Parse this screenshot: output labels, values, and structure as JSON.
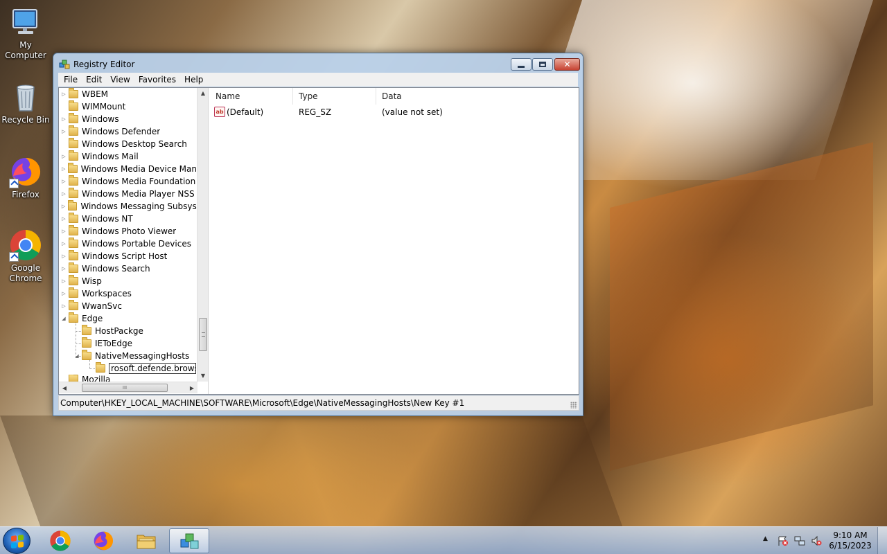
{
  "desktop": {
    "icons": [
      {
        "label": "My Computer",
        "icon": "computer-icon"
      },
      {
        "label": "Recycle Bin",
        "icon": "recycle-bin-icon"
      },
      {
        "label": "Firefox",
        "icon": "firefox-icon"
      },
      {
        "label": "Google Chrome",
        "icon": "chrome-icon"
      }
    ]
  },
  "window": {
    "title": "Registry Editor",
    "menu": [
      "File",
      "Edit",
      "View",
      "Favorites",
      "Help"
    ],
    "tree": [
      {
        "label": "WBEM"
      },
      {
        "label": "WIMMount"
      },
      {
        "label": "Windows"
      },
      {
        "label": "Windows Defender"
      },
      {
        "label": "Windows Desktop Search"
      },
      {
        "label": "Windows Mail"
      },
      {
        "label": "Windows Media Device Manag"
      },
      {
        "label": "Windows Media Foundation"
      },
      {
        "label": "Windows Media Player NSS"
      },
      {
        "label": "Windows Messaging Subsyster"
      },
      {
        "label": "Windows NT"
      },
      {
        "label": "Windows Photo Viewer"
      },
      {
        "label": "Windows Portable Devices"
      },
      {
        "label": "Windows Script Host"
      },
      {
        "label": "Windows Search"
      },
      {
        "label": "Wisp"
      },
      {
        "label": "Workspaces"
      },
      {
        "label": "WwanSvc"
      },
      {
        "label": "Edge"
      },
      {
        "label": "HostPackge"
      },
      {
        "label": "IEToEdge"
      },
      {
        "label": "NativeMessagingHosts"
      },
      {
        "label": "rosoft.defende.browser"
      },
      {
        "label": "Mozilla"
      }
    ],
    "columns": {
      "name": "Name",
      "type": "Type",
      "data": "Data"
    },
    "values": [
      {
        "name": "(Default)",
        "type": "REG_SZ",
        "data": "(value not set)",
        "icon": "string-value-icon"
      }
    ],
    "status": "Computer\\HKEY_LOCAL_MACHINE\\SOFTWARE\\Microsoft\\Edge\\NativeMessagingHosts\\New Key #1",
    "hscroll_thumb_glyph": "III"
  },
  "taskbar": {
    "apps": [
      "Google Chrome",
      "Firefox",
      "Windows Explorer",
      "Registry Editor"
    ],
    "clock": {
      "time": "9:10 AM",
      "date": "6/15/2023"
    }
  }
}
